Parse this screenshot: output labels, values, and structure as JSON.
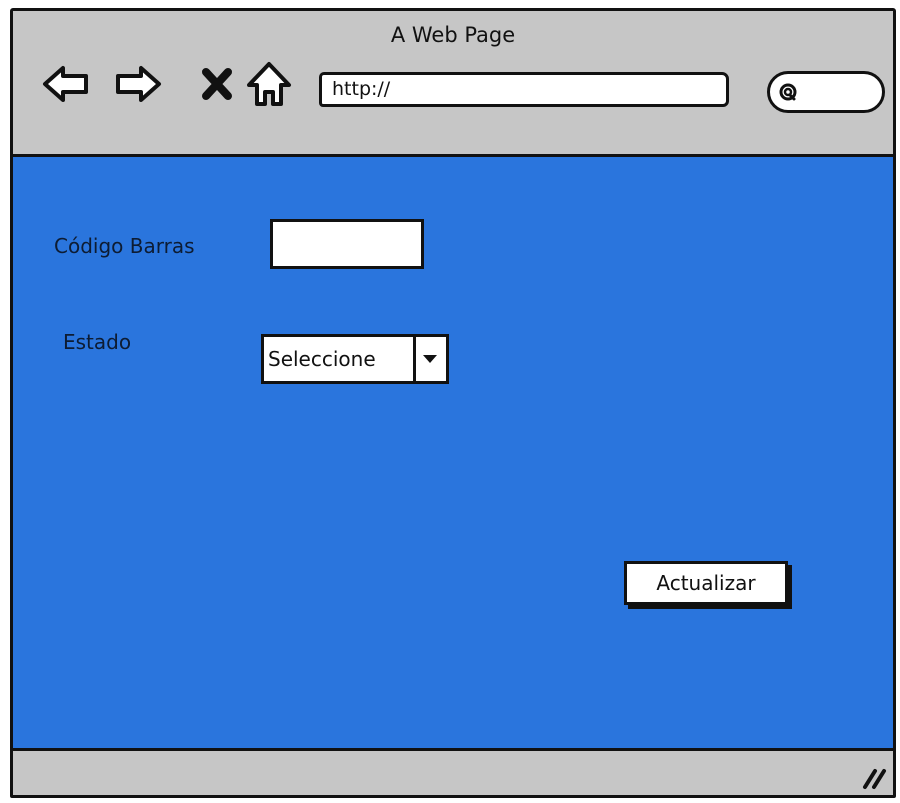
{
  "window": {
    "title": "A Web Page",
    "url": "http://"
  },
  "icons": {
    "back": "back-arrow-icon",
    "forward": "forward-arrow-icon",
    "stop": "close-icon",
    "home": "home-icon",
    "search": "search-icon",
    "resize": "resize-grip-icon"
  },
  "form": {
    "barcode_label": "Código Barras",
    "barcode_value": "",
    "status_label": "Estado",
    "status_selected": "Seleccione",
    "update_button": "Actualizar"
  },
  "colors": {
    "content_background": "#2a75dd",
    "chrome": "#c6c6c6"
  }
}
